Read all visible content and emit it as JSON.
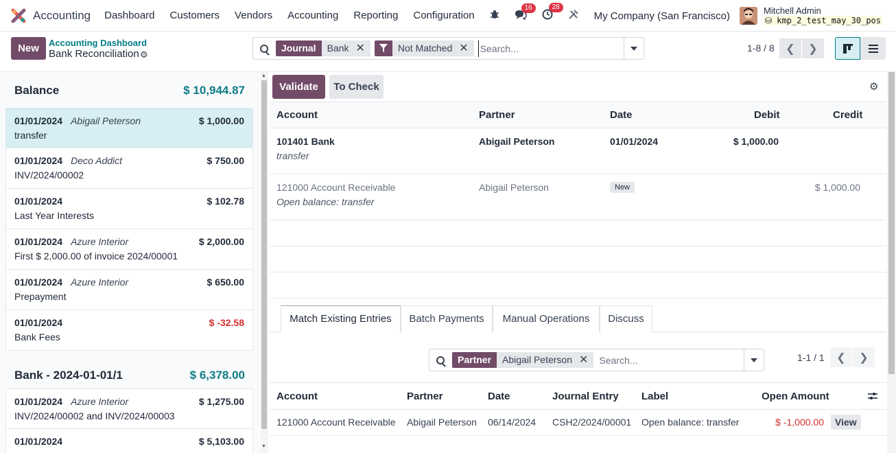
{
  "navbar": {
    "app_title": "Accounting",
    "menu": [
      "Dashboard",
      "Customers",
      "Vendors",
      "Accounting",
      "Reporting",
      "Configuration"
    ],
    "messages_count": "16",
    "activities_count": "28",
    "company": "My Company (San Francisco)",
    "user_name": "Mitchell Admin",
    "db_name": "kmp_2_test_may_30_pos"
  },
  "control_panel": {
    "new_label": "New",
    "breadcrumb_parent": "Accounting Dashboard",
    "breadcrumb_current": "Bank Reconciliation",
    "facets": [
      {
        "key": "Journal",
        "value": "Bank"
      },
      {
        "key": "filter-icon",
        "value": "Not Matched"
      }
    ],
    "search_placeholder": "Search...",
    "pager": "1-8 / 8"
  },
  "left_panel": {
    "sections": [
      {
        "title": "Balance",
        "amount": "$ 10,944.87",
        "lines": [
          {
            "date": "01/01/2024",
            "partner": "Abigail Peterson",
            "amount": "$ 1,000.00",
            "label": "transfer",
            "selected": true
          },
          {
            "date": "01/01/2024",
            "partner": "Deco Addict",
            "amount": "$ 750.00",
            "label": "INV/2024/00002"
          },
          {
            "date": "01/01/2024",
            "partner": "",
            "amount": "$ 102.78",
            "label": "Last Year Interests"
          },
          {
            "date": "01/01/2024",
            "partner": "Azure Interior",
            "amount": "$ 2,000.00",
            "label": "First $ 2,000.00 of invoice 2024/00001"
          },
          {
            "date": "01/01/2024",
            "partner": "Azure Interior",
            "amount": "$ 650.00",
            "label": "Prepayment"
          },
          {
            "date": "01/01/2024",
            "partner": "",
            "amount": "$ -32.58",
            "label": "Bank Fees",
            "negative": true
          }
        ]
      },
      {
        "title": "Bank - 2024-01-01/1",
        "amount": "$ 6,378.00",
        "lines": [
          {
            "date": "01/01/2024",
            "partner": "Azure Interior",
            "amount": "$ 1,275.00",
            "label": "INV/2024/00002 and INV/2024/00003"
          },
          {
            "date": "01/01/2024",
            "partner": "",
            "amount": "$ 5,103.00",
            "label": ""
          }
        ]
      }
    ]
  },
  "right_panel": {
    "validate_label": "Validate",
    "to_check_label": "To Check",
    "columns": [
      "Account",
      "Partner",
      "Date",
      "Debit",
      "Credit"
    ],
    "lines": [
      {
        "account": "101401 Bank",
        "sub": "transfer",
        "partner": "Abigail Peterson",
        "date": "01/01/2024",
        "debit": "$ 1,000.00",
        "credit": ""
      },
      {
        "account": "121000 Account Receivable",
        "sub": "Open balance: transfer",
        "partner": "Abigail Peterson",
        "badge": "New",
        "debit": "",
        "credit": "$ 1,000.00"
      }
    ],
    "tabs": [
      "Match Existing Entries",
      "Batch Payments",
      "Manual Operations",
      "Discuss"
    ],
    "match": {
      "facet_key": "Partner",
      "facet_value": "Abigail Peterson",
      "search_placeholder": "Search...",
      "pager": "1-1 / 1",
      "columns": [
        "Account",
        "Partner",
        "Date",
        "Journal Entry",
        "Label",
        "Open Amount"
      ],
      "rows": [
        {
          "account": "121000 Account Receivable",
          "partner": "Abigail Peterson",
          "date": "06/14/2024",
          "entry": "CSH2/2024/00001",
          "label": "Open balance: transfer",
          "amount": "$ -1,000.00",
          "view_label": "View"
        }
      ]
    }
  },
  "colors": {
    "primary": "#714b67",
    "teal": "#017e84",
    "negative": "#d32f2f"
  }
}
